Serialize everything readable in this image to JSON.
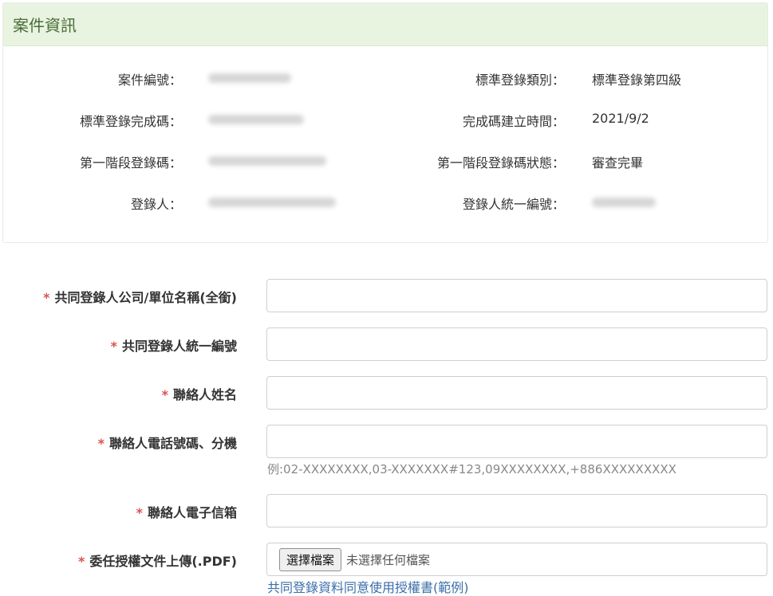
{
  "panel": {
    "title": "案件資訊"
  },
  "info": [
    {
      "label1": "案件編號：",
      "value1": "EPS2108120",
      "label2": "標準登錄類別：",
      "value2": "標準登錄第四級"
    },
    {
      "label1": "標準登錄完成碼：",
      "value1": "ESR11061102",
      "label2": "完成碼建立時間：",
      "value2": "2021/9/2"
    },
    {
      "label1": "第一階段登錄碼：",
      "value1": "EPEPSA20105836",
      "label2": "第一階段登錄碼狀態：",
      "value2": "審查完畢"
    },
    {
      "label1": "登錄人：",
      "value1": "東盛控股有限公司",
      "label2": "登錄人統一編號：",
      "value2": "28223468"
    }
  ],
  "form": {
    "required_mark": "*",
    "company_name": {
      "label": "共同登錄人公司/單位名稱(全銜)",
      "value": ""
    },
    "tax_id": {
      "label": "共同登錄人統一編號",
      "value": ""
    },
    "contact_name": {
      "label": "聯絡人姓名",
      "value": ""
    },
    "phone": {
      "label": "聯絡人電話號碼、分機",
      "value": "",
      "hint": "例:02-XXXXXXXX,03-XXXXXXX#123,09XXXXXXXX,+886XXXXXXXXX"
    },
    "email": {
      "label": "聯絡人電子信箱",
      "value": ""
    },
    "upload": {
      "label": "委任授權文件上傳(.PDF)",
      "button": "選擇檔案",
      "status": "未選擇任何檔案",
      "sample_link": "共同登錄資料同意使用授權書(範例)"
    }
  },
  "colors": {
    "header_bg": "#e8f4df",
    "header_text": "#4b6b3a",
    "required": "#d9534f",
    "link": "#3b6ea8"
  }
}
